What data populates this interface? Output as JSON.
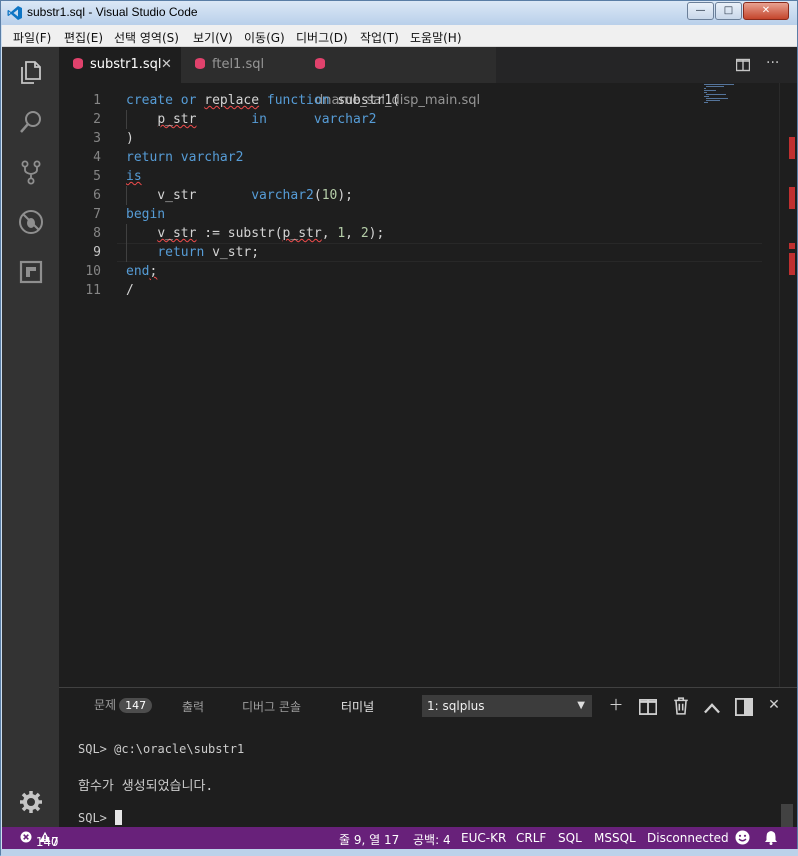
{
  "window": {
    "title": "substr1.sql - Visual Studio Code",
    "minimize": "—",
    "maximize": "□",
    "close": "✕"
  },
  "menu": [
    "파일(F)",
    "편집(E)",
    "선택 영역(S)",
    "보기(V)",
    "이동(G)",
    "디버그(D)",
    "작업(T)",
    "도움말(H)"
  ],
  "activity_icons": [
    "explorer-icon",
    "search-icon",
    "source-control-icon",
    "debug-icon",
    "extensions-icon",
    "settings-gear-icon"
  ],
  "tabs": [
    {
      "label": "substr1.sql",
      "active": true,
      "close": "✕"
    },
    {
      "label": "ftel1.sql",
      "active": false
    },
    {
      "label": "dname_sal_disp_main.sql",
      "active": false
    }
  ],
  "tab_actions": {
    "split": "split-editor-icon",
    "more": "···"
  },
  "code": {
    "current_line": 9,
    "lines": [
      {
        "n": "1",
        "tokens": [
          [
            "kw",
            "create"
          ],
          [
            "t",
            " "
          ],
          [
            "kw",
            "or"
          ],
          [
            "t",
            " "
          ],
          [
            "sq",
            "replace"
          ],
          [
            "t",
            " "
          ],
          [
            "kw",
            "function"
          ],
          [
            "t",
            " substr1("
          ]
        ]
      },
      {
        "n": "2",
        "tokens": [
          [
            "t",
            "    "
          ],
          [
            "sq",
            "p_str"
          ],
          [
            "t",
            "       "
          ],
          [
            "kw",
            "in"
          ],
          [
            "t",
            "      "
          ],
          [
            "kw",
            "varchar2"
          ]
        ]
      },
      {
        "n": "3",
        "tokens": [
          [
            "t",
            ")"
          ]
        ]
      },
      {
        "n": "4",
        "tokens": [
          [
            "kw",
            "return"
          ],
          [
            "t",
            " "
          ],
          [
            "kw",
            "varchar2"
          ]
        ]
      },
      {
        "n": "5",
        "tokens": [
          [
            "kwsq",
            "is"
          ]
        ]
      },
      {
        "n": "6",
        "tokens": [
          [
            "t",
            "    v_str       "
          ],
          [
            "kw",
            "varchar2"
          ],
          [
            "t",
            "("
          ],
          [
            "num",
            "10"
          ],
          [
            "t",
            ");"
          ]
        ]
      },
      {
        "n": "7",
        "tokens": [
          [
            "kw",
            "begin"
          ]
        ]
      },
      {
        "n": "8",
        "tokens": [
          [
            "t",
            "    "
          ],
          [
            "sq",
            "v_str"
          ],
          [
            "t",
            " := substr("
          ],
          [
            "sq",
            "p_str"
          ],
          [
            "t",
            ", "
          ],
          [
            "num",
            "1"
          ],
          [
            "t",
            ", "
          ],
          [
            "num",
            "2"
          ],
          [
            "t",
            ");"
          ]
        ]
      },
      {
        "n": "9",
        "tokens": [
          [
            "t",
            "    "
          ],
          [
            "kw",
            "return"
          ],
          [
            "t",
            " v_str;"
          ]
        ]
      },
      {
        "n": "10",
        "tokens": [
          [
            "kw",
            "end"
          ],
          [
            "sq",
            ";"
          ]
        ]
      },
      {
        "n": "11",
        "tokens": [
          [
            "t",
            "/"
          ]
        ]
      }
    ]
  },
  "panel": {
    "tabs": {
      "problems": "문제",
      "output": "출력",
      "debug_console": "디버그 콘솔",
      "terminal": "터미널"
    },
    "problems_count": "147",
    "terminal_select": "1: sqlplus",
    "terminal_lines": [
      "SQL> @c:\\oracle\\substr1",
      "함수가 생성되었습니다.",
      "SQL> "
    ]
  },
  "status": {
    "errors": "147",
    "warnings": "0",
    "position": "줄 9, 열 17",
    "spaces": "공백: 4",
    "encoding": "EUC-KR",
    "eol": "CRLF",
    "language": "SQL",
    "dialect": "MSSQL",
    "connection": "Disconnected"
  },
  "colors": {
    "status_bar": "#68217a",
    "editor_bg": "#1e1e1e",
    "keyword": "#569cd6",
    "number": "#b5cea8"
  }
}
